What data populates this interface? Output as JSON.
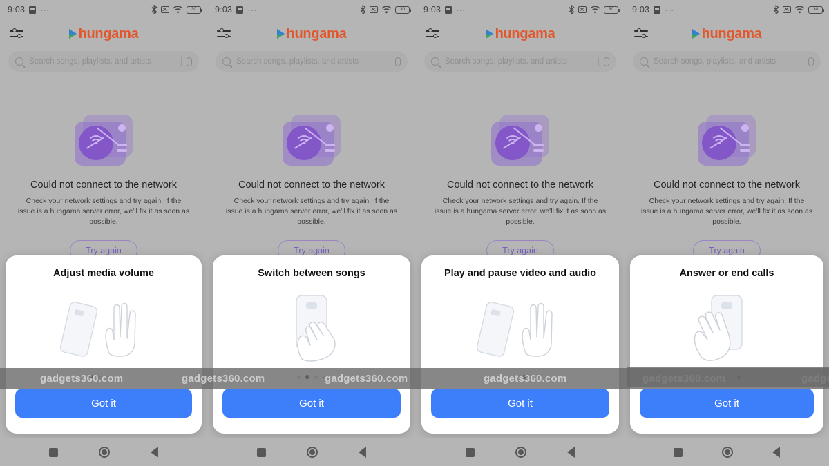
{
  "meta": {
    "device_count": 4
  },
  "statusbar": {
    "time": "9:03",
    "overflow_dots": "···",
    "icons": [
      "screenshot-icon",
      "bluetooth-icon",
      "mute-icon",
      "wifi-icon",
      "battery-icon"
    ],
    "battery_level": "30"
  },
  "header": {
    "tuner_label": "equalizer-settings",
    "logo_text": "hungama",
    "logo_color": "#e2572c"
  },
  "search": {
    "placeholder": "Search songs, playlists, and artists",
    "value": "",
    "mic_label": "voice-search"
  },
  "error": {
    "title": "Could not connect to the network",
    "subtitle": "Check your network settings and try again. If the issue is a hungama server error, we'll fix it as soon as possible.",
    "button_label": "Try again",
    "button_color": "#7a5fc0",
    "illustration": "turntable-no-network"
  },
  "gesture_modals": [
    {
      "title": "Adjust media volume",
      "illustration": "hand-swipe-vertical",
      "button_label": "Got it",
      "active_dot": 0,
      "dot_count": 4
    },
    {
      "title": "Switch between songs",
      "illustration": "hand-swipe-horizontal",
      "button_label": "Got it",
      "active_dot": 1,
      "dot_count": 4
    },
    {
      "title": "Play and pause video and audio",
      "illustration": "hand-open-palm",
      "button_label": "Got it",
      "active_dot": 2,
      "dot_count": 4
    },
    {
      "title": "Answer or end calls",
      "illustration": "hand-grab-phone",
      "button_label": "Got it",
      "active_dot": 3,
      "dot_count": 4
    }
  ],
  "modal_button_color": "#3d7efa",
  "watermark": {
    "text": "gadgets360.com",
    "occurrences": 6
  },
  "navbar": {
    "recents_label": "recent-apps",
    "home_label": "home",
    "back_label": "back"
  }
}
